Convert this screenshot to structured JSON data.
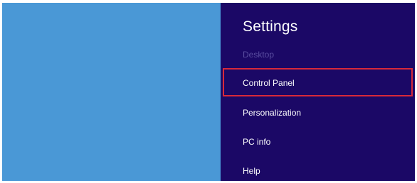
{
  "settings_panel": {
    "title": "Settings",
    "items": [
      {
        "label": "Desktop",
        "enabled": false
      },
      {
        "label": "Control Panel",
        "enabled": true,
        "highlighted": true
      },
      {
        "label": "Personalization",
        "enabled": true
      },
      {
        "label": "PC info",
        "enabled": true
      },
      {
        "label": "Help",
        "enabled": true
      }
    ]
  },
  "colors": {
    "desktop_background": "#4a98d6",
    "panel_background": "#1b0866",
    "highlight_border": "#d8293a",
    "disabled_text": "#5a4ea0"
  }
}
